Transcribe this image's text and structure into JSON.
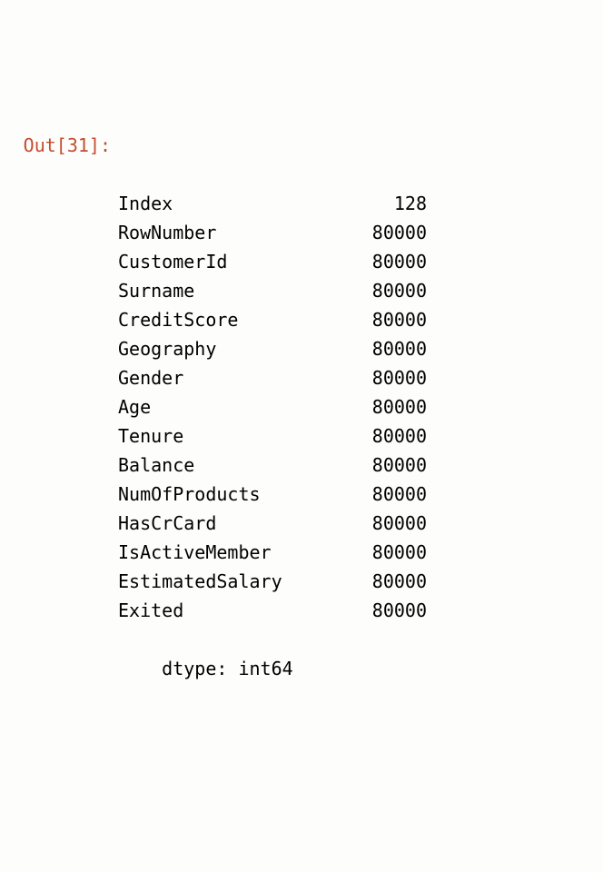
{
  "prompt": "Out[31]:",
  "series": {
    "rows": [
      {
        "label": "Index",
        "value": "128"
      },
      {
        "label": "RowNumber",
        "value": "80000"
      },
      {
        "label": "CustomerId",
        "value": "80000"
      },
      {
        "label": "Surname",
        "value": "80000"
      },
      {
        "label": "CreditScore",
        "value": "80000"
      },
      {
        "label": "Geography",
        "value": "80000"
      },
      {
        "label": "Gender",
        "value": "80000"
      },
      {
        "label": "Age",
        "value": "80000"
      },
      {
        "label": "Tenure",
        "value": "80000"
      },
      {
        "label": "Balance",
        "value": "80000"
      },
      {
        "label": "NumOfProducts",
        "value": "80000"
      },
      {
        "label": "HasCrCard",
        "value": "80000"
      },
      {
        "label": "IsActiveMember",
        "value": "80000"
      },
      {
        "label": "EstimatedSalary",
        "value": "80000"
      },
      {
        "label": "Exited",
        "value": "80000"
      }
    ],
    "footer": "dtype: int64"
  }
}
